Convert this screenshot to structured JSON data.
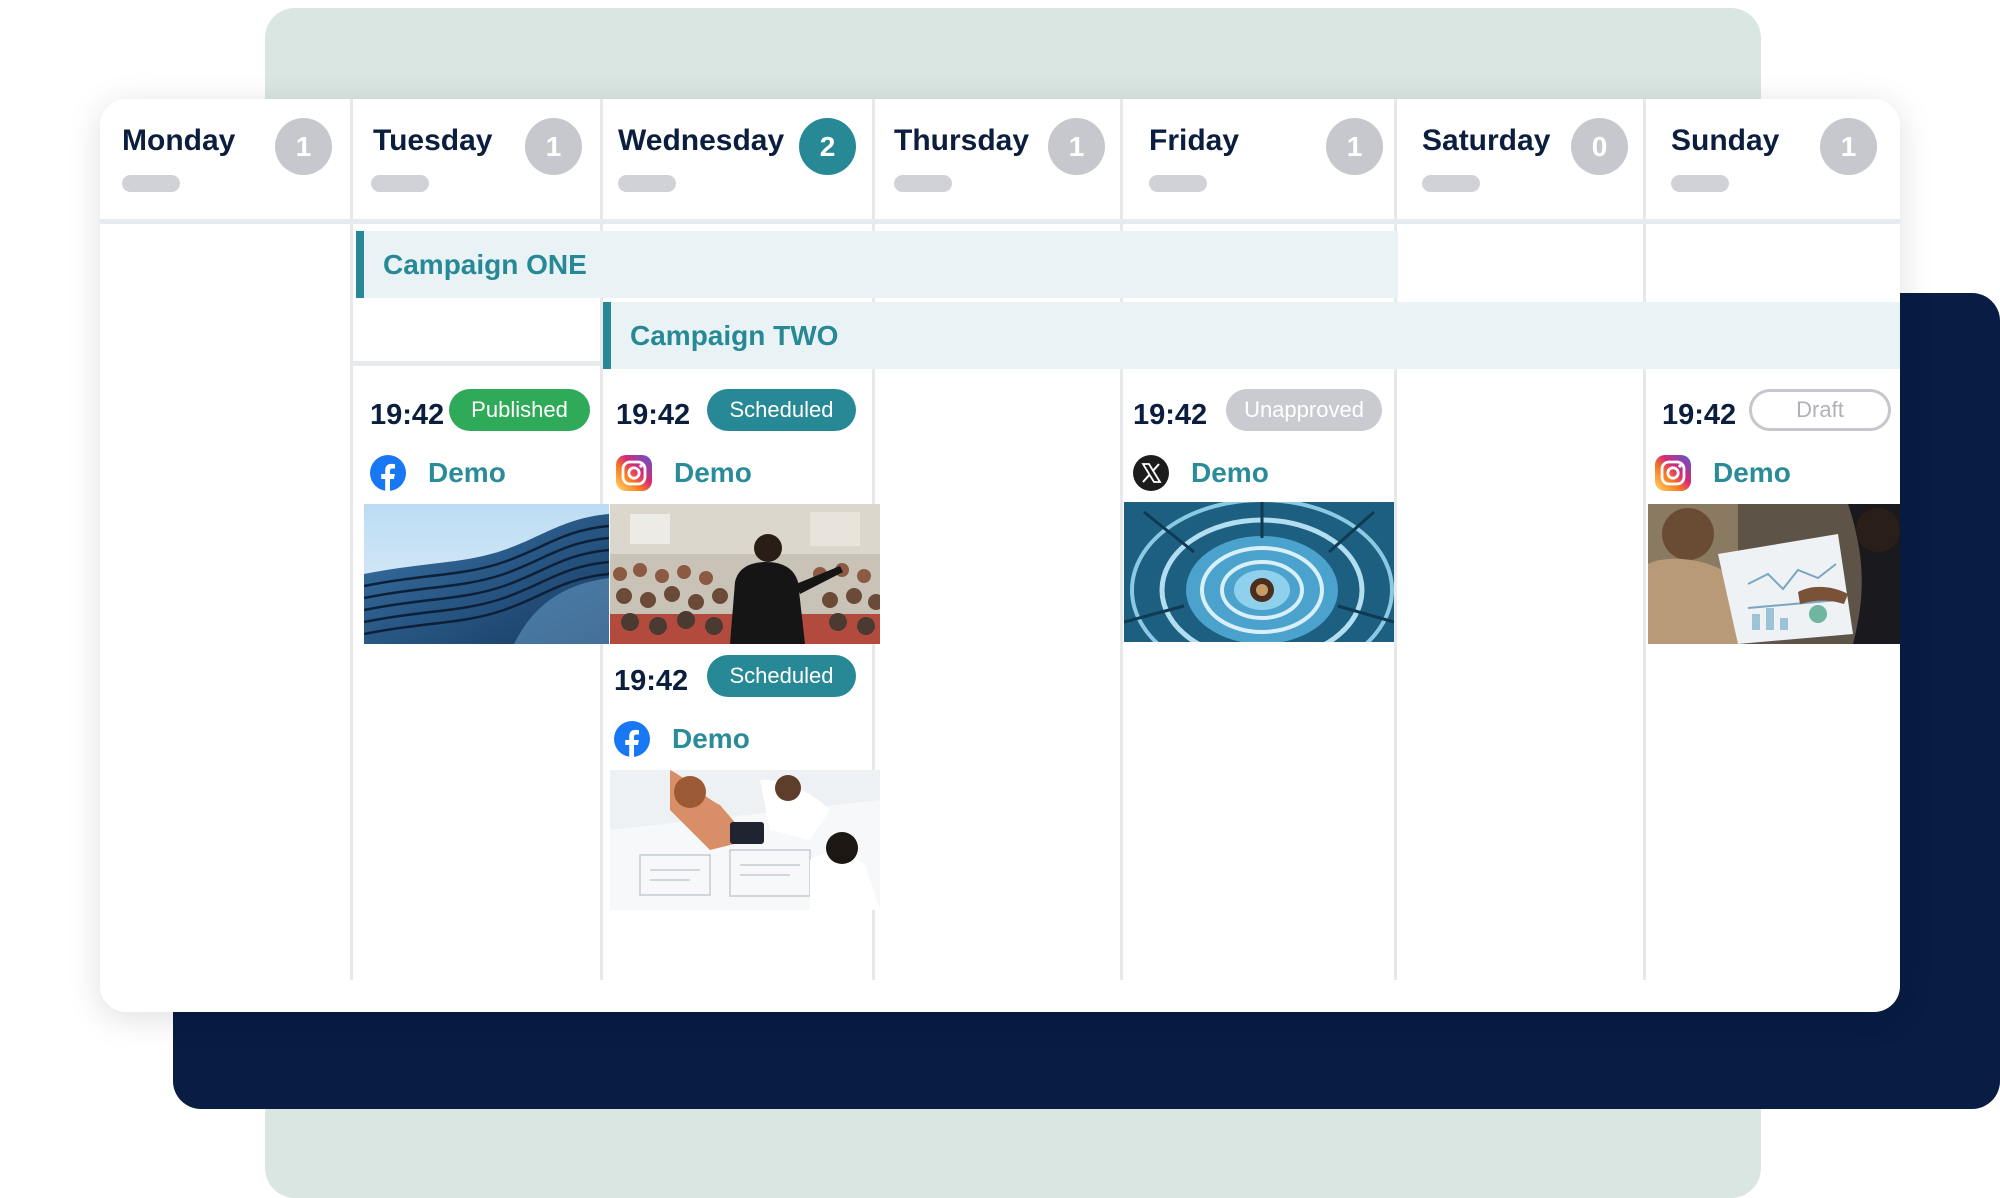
{
  "days": [
    {
      "name": "Monday",
      "count": "1"
    },
    {
      "name": "Tuesday",
      "count": "1"
    },
    {
      "name": "Wednesday",
      "count": "2"
    },
    {
      "name": "Thursday",
      "count": "1"
    },
    {
      "name": "Friday",
      "count": "1"
    },
    {
      "name": "Saturday",
      "count": "0"
    },
    {
      "name": "Sunday",
      "count": "1"
    }
  ],
  "campaigns": [
    {
      "name": "Campaign ONE",
      "start_day": "Tuesday",
      "end_day": "Friday"
    },
    {
      "name": "Campaign TWO",
      "start_day": "Wednesday",
      "end_day": "Sunday"
    }
  ],
  "posts": [
    {
      "day": "Tuesday",
      "time": "19:42",
      "status": "Published",
      "network": "facebook-icon",
      "account": "Demo",
      "image": "glass-building-photo"
    },
    {
      "day": "Wednesday",
      "time": "19:42",
      "status": "Scheduled",
      "network": "instagram-icon",
      "account": "Demo",
      "image": "conference-speaker-photo"
    },
    {
      "day": "Wednesday",
      "time": "19:42",
      "status": "Scheduled",
      "network": "facebook-icon",
      "account": "Demo",
      "image": "team-meeting-photo"
    },
    {
      "day": "Friday",
      "time": "19:42",
      "status": "Unapproved",
      "network": "x-icon",
      "account": "Demo",
      "image": "spiral-staircase-photo"
    },
    {
      "day": "Sunday",
      "time": "19:42",
      "status": "Draft",
      "network": "instagram-icon",
      "account": "Demo",
      "image": "charts-discussion-photo"
    }
  ],
  "colors": {
    "accent": "#268995",
    "navy": "#081c44",
    "published": "#2eaa59",
    "unapproved": "#c9cbd0",
    "campaign_bg": "#e9f2f5"
  }
}
